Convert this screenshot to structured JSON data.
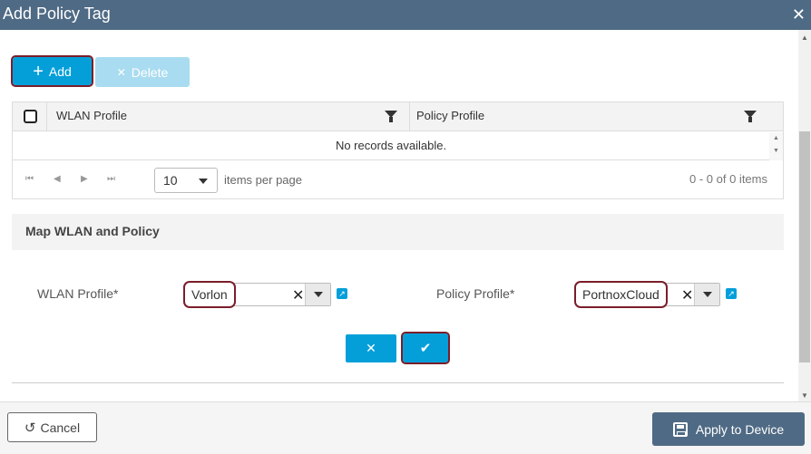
{
  "dialog": {
    "title": "Add Policy Tag",
    "close_glyph": "✕"
  },
  "toolbar": {
    "add_icon": "+",
    "add_label": "Add",
    "delete_icon": "✕",
    "delete_label": "Delete"
  },
  "grid": {
    "columns": [
      "WLAN Profile",
      "Policy Profile"
    ],
    "empty_message": "No records available.",
    "pager": {
      "first": "⏮",
      "prev": "◀",
      "next": "▶",
      "last": "⏭",
      "page_size": "10",
      "items_per_page_label": "items per page",
      "count_text": "0 - 0 of 0 items"
    }
  },
  "map_section": {
    "title": "Map WLAN and Policy",
    "wlan_label": "WLAN Profile*",
    "wlan_value": "Vorlon",
    "policy_label": "Policy Profile*",
    "policy_value": "PortnoxCloud",
    "clear_glyph": "✕",
    "cancel_glyph": "✕",
    "confirm_glyph": "✔"
  },
  "footer": {
    "cancel_icon": "↺",
    "cancel_label": "Cancel",
    "apply_label": "Apply to Device"
  },
  "colors": {
    "header_bg": "#4f6a84",
    "primary": "#049fd9",
    "highlight": "#7a1e2a"
  }
}
